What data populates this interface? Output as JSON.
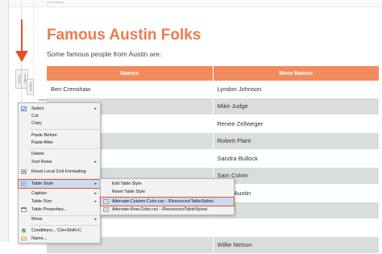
{
  "editor": {
    "top_label": "new markup",
    "vtag_1": "<html>",
    "vtag_2": "<body>",
    "vtag_3": "<table>",
    "table_tag": "<table>"
  },
  "page": {
    "title": "Famous Austin Folks",
    "subtitle": "Some famous people from Austin are:"
  },
  "table": {
    "headers": [
      "Names",
      "More Names"
    ],
    "rows": [
      [
        "Ben Crenshaw",
        "Lyndon Johnson"
      ],
      [
        "",
        "Mike Judge"
      ],
      [
        "",
        "Renee Zellweger"
      ],
      [
        "",
        "Robert Plant"
      ],
      [
        "",
        "Sandra Bullock"
      ],
      [
        "",
        "Sam Colvin"
      ],
      [
        "",
        "Steve Austin"
      ],
      [
        "",
        ""
      ],
      [
        "",
        ""
      ],
      [
        "",
        "Willie Nelson"
      ]
    ]
  },
  "context_menu": {
    "items": [
      {
        "label": "Select",
        "arrow": "▸",
        "icon": "select-icon"
      },
      {
        "label": "Cut",
        "arrow": "",
        "icon": ""
      },
      {
        "label": "Copy",
        "arrow": "",
        "icon": ""
      },
      {
        "label": "Paste Before",
        "arrow": "",
        "icon": ""
      },
      {
        "label": "Paste After",
        "arrow": "",
        "icon": ""
      },
      {
        "label": "Delete",
        "arrow": "",
        "icon": ""
      },
      {
        "label": "Sort Rows",
        "arrow": "▸",
        "icon": ""
      },
      {
        "label": "Reset Local Cell Formatting",
        "arrow": "",
        "icon": "reset-format-icon"
      },
      {
        "label": "Table Style",
        "arrow": "▸",
        "icon": "table-style-icon"
      },
      {
        "label": "Caption",
        "arrow": "▸",
        "icon": ""
      },
      {
        "label": "Table Size",
        "arrow": "▸",
        "icon": ""
      },
      {
        "label": "Table Properties...",
        "arrow": "",
        "icon": "table-properties-icon"
      },
      {
        "label": "Move",
        "arrow": "▸",
        "icon": ""
      },
      {
        "label": "Conditions...         Ctrl+Shift+C",
        "arrow": "",
        "icon": "conditions-icon"
      },
      {
        "label": "Name...",
        "arrow": "",
        "icon": "name-icon"
      }
    ]
  },
  "submenu": {
    "items": [
      {
        "label": "Edit Table Style"
      },
      {
        "label": "Reset Table Style"
      },
      {
        "label": "Alternate-Column-Color.css - /Resources/TableStyles/"
      },
      {
        "label": "Alternate-Row-Color.css - /Resources/TableStyles/"
      }
    ]
  },
  "colors": {
    "accent": "#f07a4e",
    "header_bg": "#f08b5c",
    "row_alt": "#d9dddc",
    "highlight_outline": "#e8502a",
    "menu_highlight": "#c9dcf3"
  }
}
